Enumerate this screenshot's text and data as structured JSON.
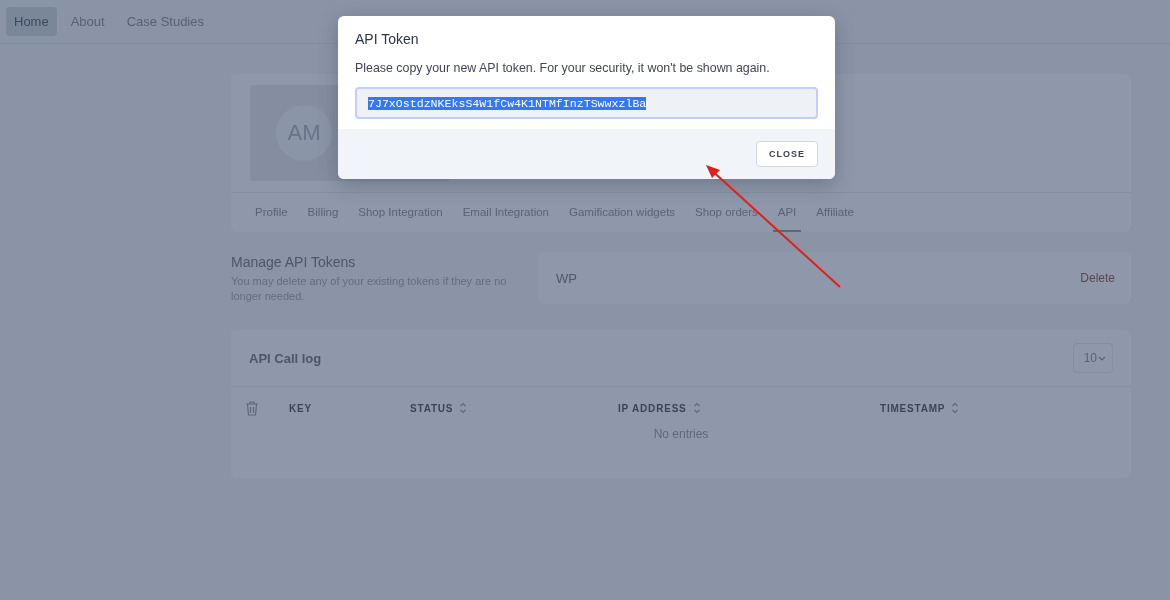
{
  "nav": {
    "items": [
      {
        "label": "Home",
        "selected": true
      },
      {
        "label": "About",
        "selected": false
      },
      {
        "label": "Case Studies",
        "selected": false
      }
    ]
  },
  "profile": {
    "avatar_initials": "AM",
    "tabs": [
      {
        "label": "Profile",
        "selected": false
      },
      {
        "label": "Billing",
        "selected": false
      },
      {
        "label": "Shop Integration",
        "selected": false
      },
      {
        "label": "Email Integration",
        "selected": false
      },
      {
        "label": "Gamification widgets",
        "selected": false
      },
      {
        "label": "Shop orders",
        "selected": false
      },
      {
        "label": "API",
        "selected": true
      },
      {
        "label": "Affiliate",
        "selected": false
      }
    ]
  },
  "tokens_section": {
    "title": "Manage API Tokens",
    "description": "You may delete any of your existing tokens if they are no longer needed.",
    "tokens": [
      {
        "name": "WP",
        "action": "Delete"
      }
    ]
  },
  "api_log": {
    "title": "API Call log",
    "page_size": "10",
    "columns": [
      {
        "label": "KEY",
        "sortable": false
      },
      {
        "label": "STATUS",
        "sortable": true
      },
      {
        "label": "IP ADDRESS",
        "sortable": true
      },
      {
        "label": "TIMESTAMP",
        "sortable": true
      }
    ],
    "empty_text": "No entries"
  },
  "modal": {
    "title": "API Token",
    "message": "Please copy your new API token. For your security, it won't be shown again.",
    "token": "7J7xOstdzNKEksS4W1fCw4K1NTMfInzTSwwxzlBa",
    "button": "CLOSE"
  }
}
